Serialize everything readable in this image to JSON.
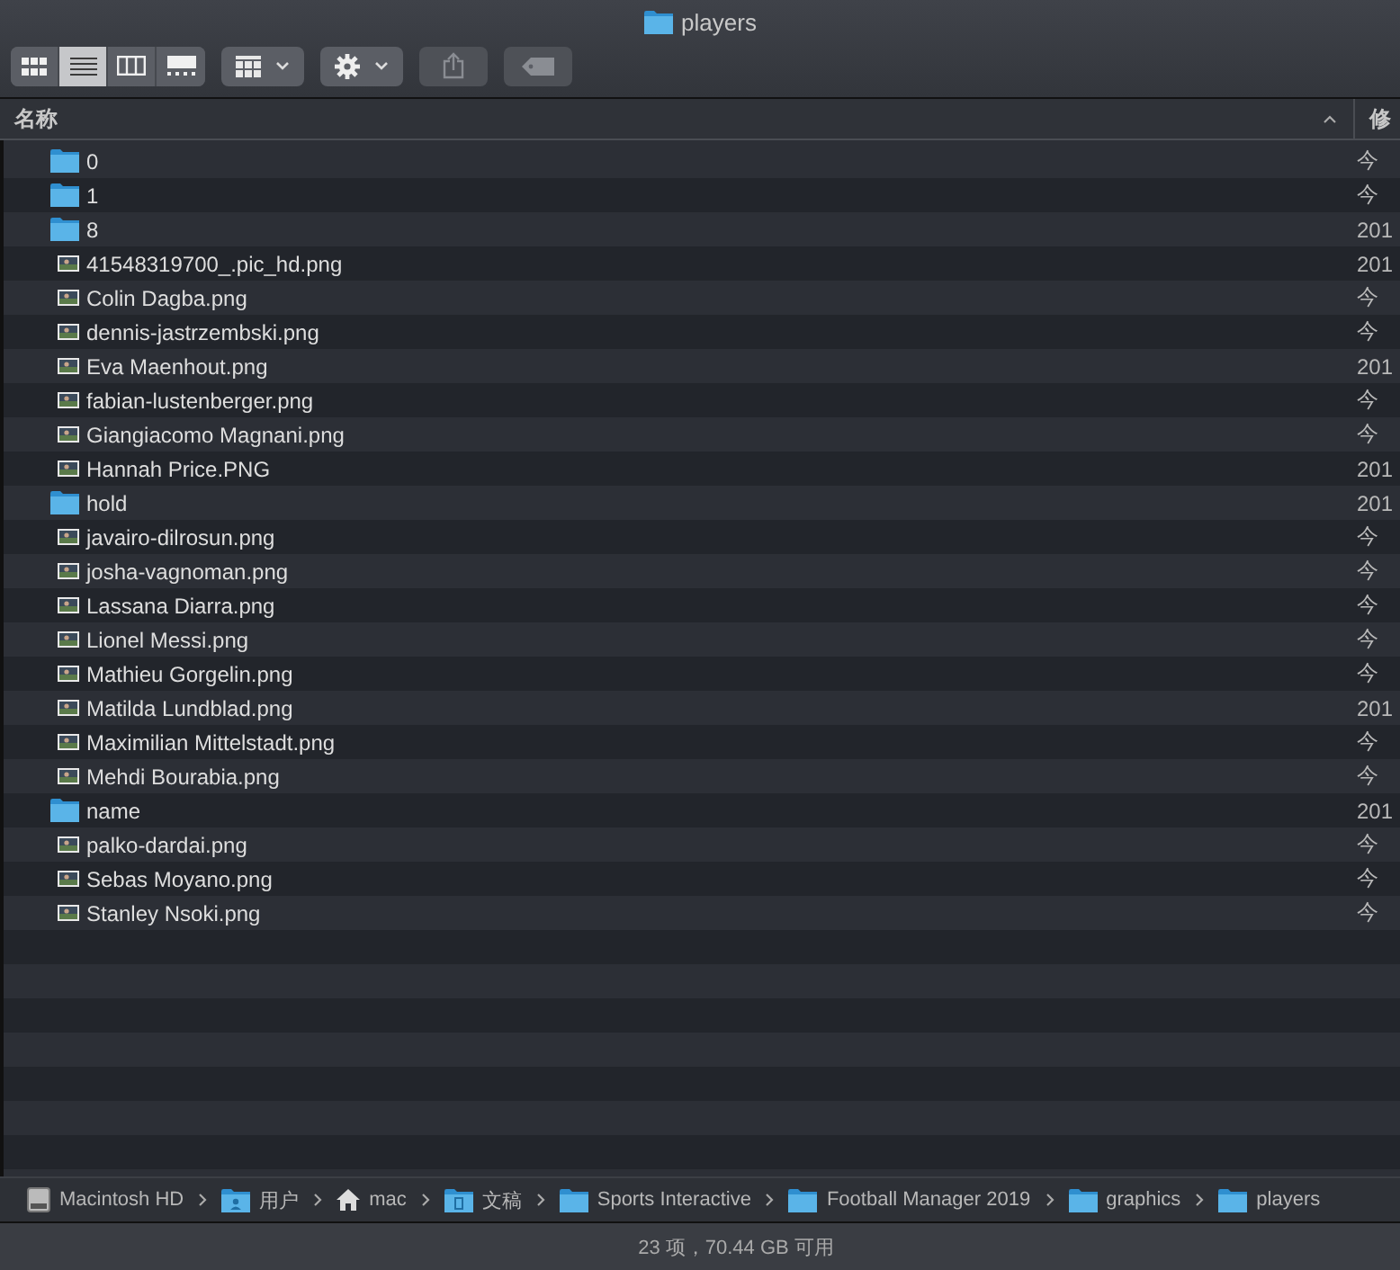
{
  "window": {
    "title": "players"
  },
  "toolbar": {
    "view_modes": [
      {
        "kind": "icons",
        "selected": false
      },
      {
        "kind": "list",
        "selected": true
      },
      {
        "kind": "columns",
        "selected": false
      },
      {
        "kind": "gallery",
        "selected": false
      }
    ]
  },
  "table": {
    "columns": [
      {
        "label": "名称"
      },
      {
        "label": "修"
      }
    ],
    "rows": [
      {
        "kind": "folder",
        "name": "0",
        "date": "今"
      },
      {
        "kind": "folder",
        "name": "1",
        "date": "今"
      },
      {
        "kind": "folder",
        "name": "8",
        "date": "201"
      },
      {
        "kind": "image",
        "name": "41548319700_.pic_hd.png",
        "date": "201"
      },
      {
        "kind": "image",
        "name": "Colin Dagba.png",
        "date": "今"
      },
      {
        "kind": "image",
        "name": "dennis-jastrzembski.png",
        "date": "今"
      },
      {
        "kind": "image",
        "name": "Eva Maenhout.png",
        "date": "201"
      },
      {
        "kind": "image",
        "name": "fabian-lustenberger.png",
        "date": "今"
      },
      {
        "kind": "image",
        "name": "Giangiacomo Magnani.png",
        "date": "今"
      },
      {
        "kind": "image",
        "name": "Hannah Price.PNG",
        "date": "201"
      },
      {
        "kind": "folder",
        "name": "hold",
        "date": "201"
      },
      {
        "kind": "image",
        "name": "javairo-dilrosun.png",
        "date": "今"
      },
      {
        "kind": "image",
        "name": "josha-vagnoman.png",
        "date": "今"
      },
      {
        "kind": "image",
        "name": "Lassana Diarra.png",
        "date": "今"
      },
      {
        "kind": "image",
        "name": "Lionel Messi.png",
        "date": "今"
      },
      {
        "kind": "image",
        "name": "Mathieu Gorgelin.png",
        "date": "今"
      },
      {
        "kind": "image",
        "name": "Matilda Lundblad.png",
        "date": "201"
      },
      {
        "kind": "image",
        "name": "Maximilian Mittelstadt.png",
        "date": "今"
      },
      {
        "kind": "image",
        "name": "Mehdi Bourabia.png",
        "date": "今"
      },
      {
        "kind": "folder",
        "name": "name",
        "date": "201"
      },
      {
        "kind": "image",
        "name": "palko-dardai.png",
        "date": "今"
      },
      {
        "kind": "image",
        "name": "Sebas Moyano.png",
        "date": "今"
      },
      {
        "kind": "image",
        "name": "Stanley Nsoki.png",
        "date": "今"
      }
    ]
  },
  "path_bar": [
    {
      "kind": "disk",
      "label": "Macintosh HD"
    },
    {
      "kind": "user",
      "label": "用户"
    },
    {
      "kind": "home",
      "label": "mac"
    },
    {
      "kind": "documents",
      "label": "文稿"
    },
    {
      "kind": "folder",
      "label": "Sports Interactive"
    },
    {
      "kind": "folder",
      "label": "Football Manager 2019"
    },
    {
      "kind": "folder",
      "label": "graphics"
    },
    {
      "kind": "folder",
      "label": "players"
    }
  ],
  "status_bar": "23 项，70.44 GB 可用"
}
